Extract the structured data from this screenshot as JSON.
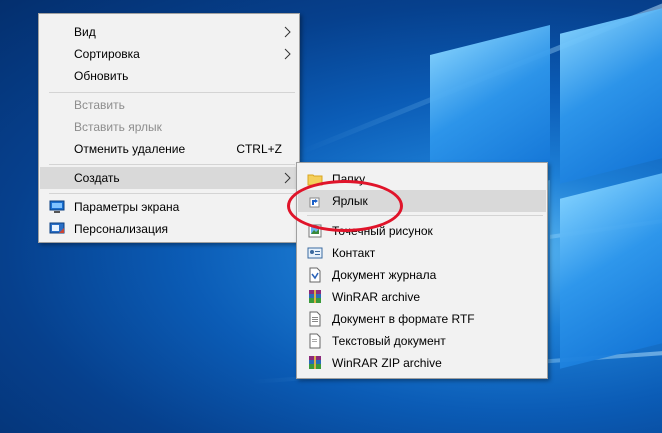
{
  "context_menu": {
    "items": [
      {
        "label": "Вид",
        "has_submenu": true
      },
      {
        "label": "Сортировка",
        "has_submenu": true
      },
      {
        "label": "Обновить"
      },
      {
        "label": "Вставить",
        "disabled": true
      },
      {
        "label": "Вставить ярлык",
        "disabled": true
      },
      {
        "label": "Отменить удаление",
        "accelerator": "CTRL+Z"
      },
      {
        "label": "Создать",
        "has_submenu": true,
        "highlighted": true
      },
      {
        "label": "Параметры экрана",
        "icon": "display-settings-icon"
      },
      {
        "label": "Персонализация",
        "icon": "personalization-icon"
      }
    ]
  },
  "create_submenu": {
    "items": [
      {
        "label": "Папку",
        "icon": "folder-icon"
      },
      {
        "label": "Ярлык",
        "icon": "shortcut-icon",
        "highlighted": true
      },
      {
        "label": "Точечный рисунок",
        "icon": "bitmap-image-icon"
      },
      {
        "label": "Контакт",
        "icon": "contact-icon"
      },
      {
        "label": "Документ журнала",
        "icon": "journal-document-icon"
      },
      {
        "label": "WinRAR archive",
        "icon": "winrar-archive-icon"
      },
      {
        "label": "Документ в формате RTF",
        "icon": "rtf-document-icon"
      },
      {
        "label": "Текстовый документ",
        "icon": "text-document-icon"
      },
      {
        "label": "WinRAR ZIP archive",
        "icon": "winrar-zip-icon"
      }
    ]
  },
  "colors": {
    "annotation_circle": "#e0142a",
    "menu_background": "#f2f2f2",
    "hover_background": "#d9d9d9"
  }
}
